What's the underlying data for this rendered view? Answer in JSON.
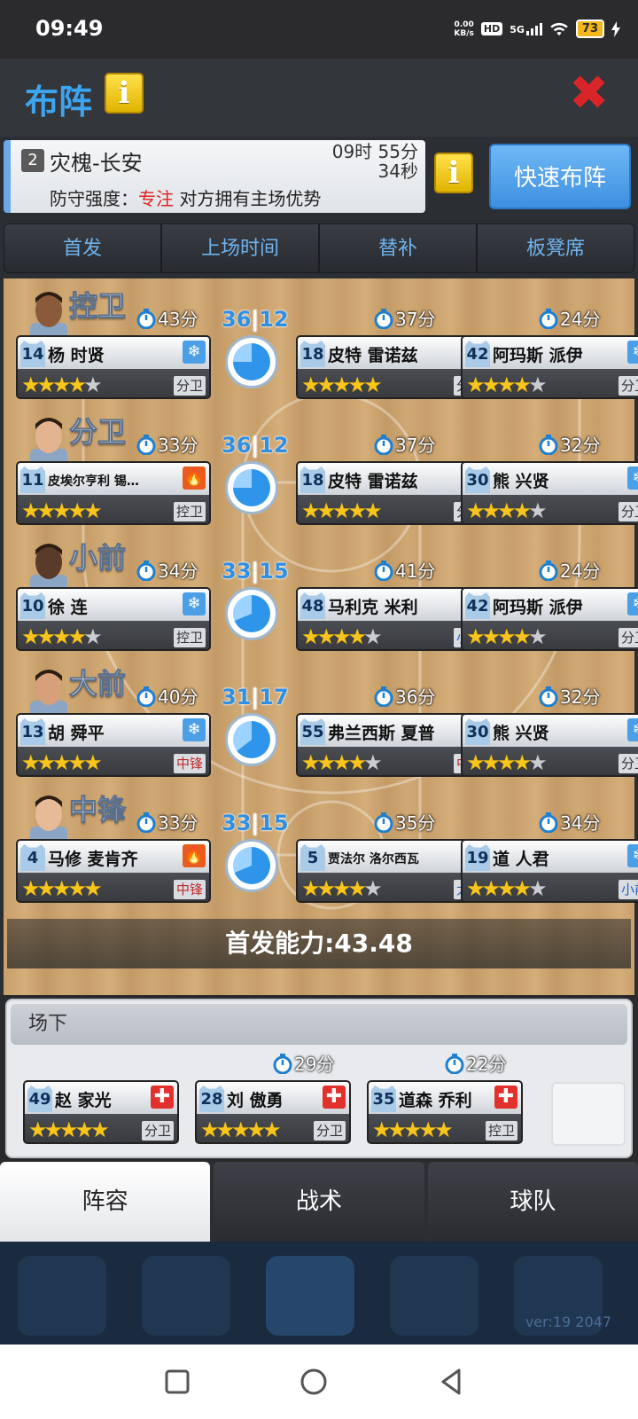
{
  "status_bar": {
    "time": "09:49",
    "net_speed_top": "0.00",
    "net_speed_bottom": "KB/s",
    "hd": "HD",
    "signal": "5G",
    "battery": "73"
  },
  "header": {
    "title": "布阵",
    "info_icon": "info-icon",
    "close_icon": "close-icon"
  },
  "match": {
    "round": "2",
    "opponent": "灾槐-长安",
    "countdown_line1": "09时 55分",
    "countdown_line2": "34秒",
    "defense_label": "防守强度：",
    "defense_value": "专注",
    "defense_note": " 对方拥有主场优势",
    "quick_lineup": "快速布阵"
  },
  "tabs": [
    "首发",
    "上场时间",
    "替补",
    "板凳席"
  ],
  "rows": [
    {
      "position": "控卫",
      "starter": {
        "minutes": "43分",
        "number": "14",
        "name": "杨 时贤",
        "condition": "cold",
        "stars": 3.5,
        "role": "分卫"
      },
      "split": {
        "left": "36",
        "right": "12"
      },
      "sub1": {
        "minutes": "37分",
        "number": "18",
        "name": "皮特 雷诺兹",
        "condition": "cold",
        "stars": 4.5,
        "role": "分卫"
      },
      "sub2": {
        "minutes": "24分",
        "number": "42",
        "name": "阿玛斯 派伊",
        "condition": "cold",
        "stars": 3.5,
        "role": "分卫"
      }
    },
    {
      "position": "分卫",
      "starter": {
        "minutes": "33分",
        "number": "11",
        "name": "皮埃尔亨利 锡…",
        "condition": "hot",
        "stars": 4.5,
        "role": "控卫"
      },
      "split": {
        "left": "36",
        "right": "12"
      },
      "sub1": {
        "minutes": "37分",
        "number": "18",
        "name": "皮特 雷诺兹",
        "condition": "cold",
        "stars": 4.5,
        "role": "分卫"
      },
      "sub2": {
        "minutes": "32分",
        "number": "30",
        "name": "熊 兴贤",
        "condition": "cold",
        "stars": 3.5,
        "role": "分卫"
      }
    },
    {
      "position": "小前",
      "starter": {
        "minutes": "34分",
        "number": "10",
        "name": "徐 连",
        "condition": "cold",
        "stars": 4,
        "role": "控卫"
      },
      "split": {
        "left": "33",
        "right": "15"
      },
      "sub1": {
        "minutes": "41分",
        "number": "48",
        "name": "马利克 米利",
        "condition": "cold",
        "stars": 3.5,
        "role": "小前"
      },
      "sub2": {
        "minutes": "24分",
        "number": "42",
        "name": "阿玛斯 派伊",
        "condition": "cold",
        "stars": 3.5,
        "role": "分卫"
      }
    },
    {
      "position": "大前",
      "starter": {
        "minutes": "40分",
        "number": "13",
        "name": "胡 舜平",
        "condition": "cold",
        "stars": 4.5,
        "role": "中锋"
      },
      "split": {
        "left": "31",
        "right": "17"
      },
      "sub1": {
        "minutes": "36分",
        "number": "55",
        "name": "弗兰西斯 夏普",
        "condition": "cold",
        "stars": 3.5,
        "role": "中锋"
      },
      "sub2": {
        "minutes": "32分",
        "number": "30",
        "name": "熊 兴贤",
        "condition": "cold",
        "stars": 3.5,
        "role": "分卫"
      }
    },
    {
      "position": "中锋",
      "starter": {
        "minutes": "33分",
        "number": "4",
        "name": "马修 麦肯齐",
        "condition": "hot",
        "stars": 4.5,
        "role": "中锋"
      },
      "split": {
        "left": "33",
        "right": "15"
      },
      "sub1": {
        "minutes": "35分",
        "number": "5",
        "name": "贾法尔 洛尔西瓦",
        "condition": "mid",
        "stars": 3.5,
        "role": "大前"
      },
      "sub2": {
        "minutes": "34分",
        "number": "19",
        "name": "道 人君",
        "condition": "cold",
        "stars": 3.5,
        "role": "小前"
      }
    }
  ],
  "starter_power": "首发能力:43.48",
  "bench": {
    "title": "场下",
    "players": [
      {
        "minutes": "",
        "number": "49",
        "name": "赵 家光",
        "condition": "injury",
        "stars": 4.5,
        "role": "分卫"
      },
      {
        "minutes": "29分",
        "number": "28",
        "name": "刘 傲勇",
        "condition": "injury",
        "stars": 4.5,
        "role": "分卫"
      },
      {
        "minutes": "22分",
        "number": "35",
        "name": "道森 乔利",
        "condition": "injury",
        "stars": 4.5,
        "role": "控卫"
      }
    ]
  },
  "bottom_tabs": [
    "阵容",
    "战术",
    "球队"
  ],
  "version": "ver:19  2047"
}
